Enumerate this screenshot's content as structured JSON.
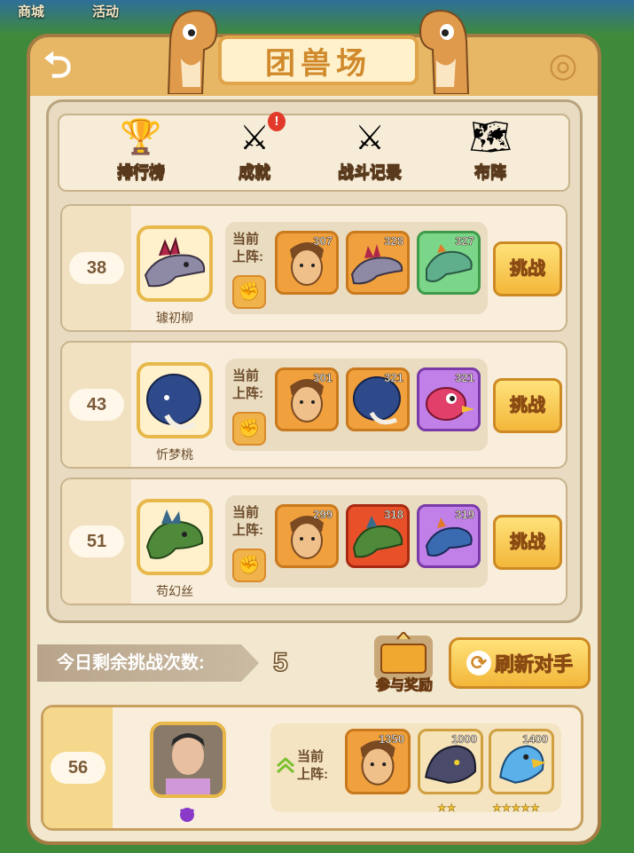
{
  "background": {
    "top_labels": [
      "商城",
      "活动"
    ]
  },
  "header": {
    "title": "团兽场"
  },
  "tabs": [
    {
      "label": "排行榜",
      "icon": "trophy-icon"
    },
    {
      "label": "成就",
      "icon": "swords-icon",
      "badge": "!"
    },
    {
      "label": "战斗记录",
      "icon": "swords-icon"
    },
    {
      "label": "布阵",
      "icon": "pk-map-icon"
    }
  ],
  "lineup_label": "当前上阵:",
  "fight_label": "挑战",
  "opponents": [
    {
      "rank": "38",
      "name": "璩初柳",
      "levels": [
        "307",
        "328",
        "327"
      ]
    },
    {
      "rank": "43",
      "name": "忻梦桃",
      "levels": [
        "301",
        "321",
        "321"
      ]
    },
    {
      "rank": "51",
      "name": "苟幻丝",
      "levels": [
        "299",
        "318",
        "319"
      ]
    }
  ],
  "remaining": {
    "label": "今日剩余挑战次数:",
    "count": "5"
  },
  "reward_label": "参与奖励",
  "refresh_label": "刷新对手",
  "me": {
    "rank": "56",
    "levels": [
      "1350",
      "1000",
      "1400"
    ],
    "stars": [
      "★★",
      "★★★★★"
    ]
  },
  "colors": {
    "accent": "#f3b73a",
    "panel": "#f2e7cf",
    "border": "#a37b43"
  }
}
